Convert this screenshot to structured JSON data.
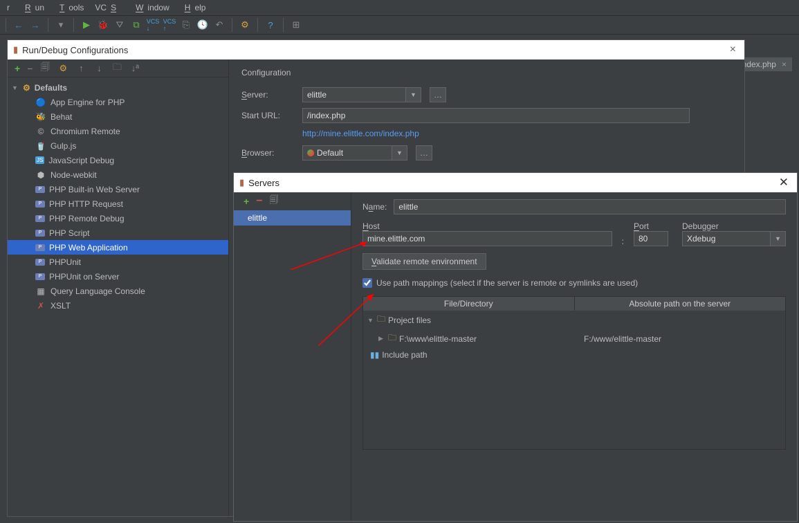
{
  "menu": {
    "items": [
      "Run",
      "Tools",
      "VCS",
      "Window",
      "Help"
    ],
    "leading": "r"
  },
  "editor_tab": {
    "icon_name": "php-file-icon",
    "label": "index.php"
  },
  "dialog": {
    "title": "Run/Debug Configurations",
    "defaults_label": "Defaults",
    "tree": [
      {
        "icon": "🔵",
        "label": "App Engine for PHP"
      },
      {
        "icon": "🐝",
        "label": "Behat"
      },
      {
        "icon": "©",
        "label": "Chromium Remote"
      },
      {
        "icon": "🥤",
        "label": "Gulp.js"
      },
      {
        "icon": "JS",
        "label": "JavaScript Debug"
      },
      {
        "icon": "⬢",
        "label": "Node-webkit"
      },
      {
        "icon": "php",
        "label": "PHP Built-in Web Server"
      },
      {
        "icon": "php",
        "label": "PHP HTTP Request"
      },
      {
        "icon": "php",
        "label": "PHP Remote Debug"
      },
      {
        "icon": "php",
        "label": "PHP Script"
      },
      {
        "icon": "php",
        "label": "PHP Web Application",
        "selected": true
      },
      {
        "icon": "php",
        "label": "PHPUnit"
      },
      {
        "icon": "php",
        "label": "PHPUnit on Server"
      },
      {
        "icon": "▦",
        "label": "Query Language Console"
      },
      {
        "icon": "✗",
        "label": "XSLT",
        "red": true
      }
    ],
    "config": {
      "heading": "Configuration",
      "server_label": "Server:",
      "server_value": "elittle",
      "start_url_label": "Start URL:",
      "start_url_value": "/index.php",
      "full_url": "http://mine.elittle.com/index.php",
      "browser_label": "Browser:",
      "browser_value": "Default"
    }
  },
  "servers": {
    "title": "Servers",
    "name_label": "Name:",
    "name_value": "elittle",
    "list_item": "elittle",
    "host_label": "Host",
    "host_value": "mine.elittle.com",
    "port_label": "Port",
    "port_value": "80",
    "debugger_label": "Debugger",
    "debugger_value": "Xdebug",
    "validate_btn": "Validate remote environment",
    "mapping_checkbox": "Use path mappings (select if the server is remote or symlinks are used)",
    "col1": "File/Directory",
    "col2": "Absolute path on the server",
    "project_files": "Project files",
    "local_path": "F:\\www\\elittle-master",
    "remote_path": "F:/www/elittle-master",
    "include_path": "Include path"
  }
}
